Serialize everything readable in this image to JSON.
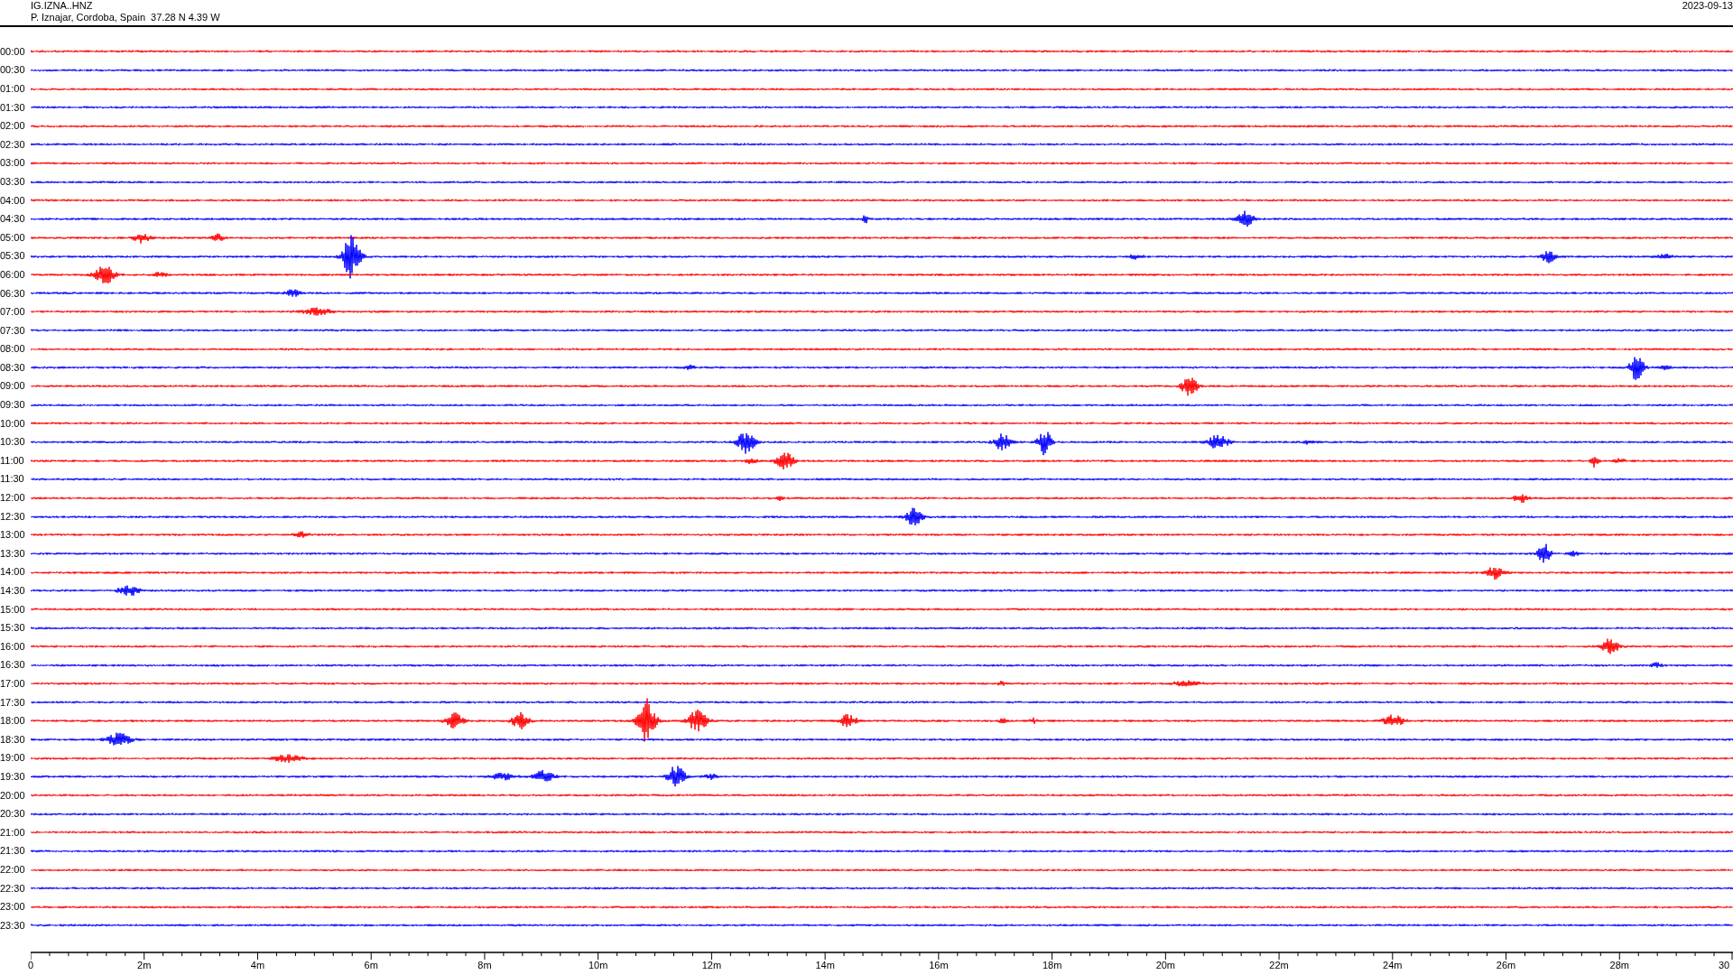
{
  "header": {
    "station": "IG.IZNA..HNZ",
    "location": "P. Iznajar, Cordoba, Spain  37.28 N 4.39 W",
    "date": "2023-09-13"
  },
  "traces": [
    {
      "time": "00:00",
      "color": "#ff0000"
    },
    {
      "time": "00:30",
      "color": "#0000ff"
    },
    {
      "time": "01:00",
      "color": "#ff0000"
    },
    {
      "time": "01:30",
      "color": "#0000ff"
    },
    {
      "time": "02:00",
      "color": "#ff0000"
    },
    {
      "time": "02:30",
      "color": "#0000ff"
    },
    {
      "time": "03:00",
      "color": "#ff0000"
    },
    {
      "time": "03:30",
      "color": "#0000ff"
    },
    {
      "time": "04:00",
      "color": "#ff0000"
    },
    {
      "time": "04:30",
      "color": "#0000ff"
    },
    {
      "time": "05:00",
      "color": "#ff0000"
    },
    {
      "time": "05:30",
      "color": "#0000ff"
    },
    {
      "time": "06:00",
      "color": "#ff0000"
    },
    {
      "time": "06:30",
      "color": "#0000ff"
    },
    {
      "time": "07:00",
      "color": "#ff0000"
    },
    {
      "time": "07:30",
      "color": "#0000ff"
    },
    {
      "time": "08:00",
      "color": "#ff0000"
    },
    {
      "time": "08:30",
      "color": "#0000ff"
    },
    {
      "time": "09:00",
      "color": "#ff0000"
    },
    {
      "time": "09:30",
      "color": "#0000ff"
    },
    {
      "time": "10:00",
      "color": "#ff0000"
    },
    {
      "time": "10:30",
      "color": "#0000ff"
    },
    {
      "time": "11:00",
      "color": "#ff0000"
    },
    {
      "time": "11:30",
      "color": "#0000ff"
    },
    {
      "time": "12:00",
      "color": "#ff0000"
    },
    {
      "time": "12:30",
      "color": "#0000ff"
    },
    {
      "time": "13:00",
      "color": "#ff0000"
    },
    {
      "time": "13:30",
      "color": "#0000ff"
    },
    {
      "time": "14:00",
      "color": "#ff0000"
    },
    {
      "time": "14:30",
      "color": "#0000ff"
    },
    {
      "time": "15:00",
      "color": "#ff0000"
    },
    {
      "time": "15:30",
      "color": "#0000ff"
    },
    {
      "time": "16:00",
      "color": "#ff0000"
    },
    {
      "time": "16:30",
      "color": "#0000ff"
    },
    {
      "time": "17:00",
      "color": "#ff0000"
    },
    {
      "time": "17:30",
      "color": "#0000ff"
    },
    {
      "time": "18:00",
      "color": "#ff0000"
    },
    {
      "time": "18:30",
      "color": "#0000ff"
    },
    {
      "time": "19:00",
      "color": "#ff0000"
    },
    {
      "time": "19:30",
      "color": "#0000ff"
    },
    {
      "time": "20:00",
      "color": "#ff0000"
    },
    {
      "time": "20:30",
      "color": "#0000ff"
    },
    {
      "time": "21:00",
      "color": "#ff0000"
    },
    {
      "time": "21:30",
      "color": "#0000ff"
    },
    {
      "time": "22:00",
      "color": "#ff0000"
    },
    {
      "time": "22:30",
      "color": "#0000ff"
    },
    {
      "time": "23:00",
      "color": "#ff0000"
    },
    {
      "time": "23:30",
      "color": "#0000ff"
    }
  ],
  "x_axis": {
    "ticks": [
      "0",
      "2m",
      "4m",
      "6m",
      "8m",
      "10m",
      "12m",
      "14m",
      "16m",
      "18m",
      "20m",
      "22m",
      "24m",
      "26m",
      "28m",
      "30"
    ]
  }
}
